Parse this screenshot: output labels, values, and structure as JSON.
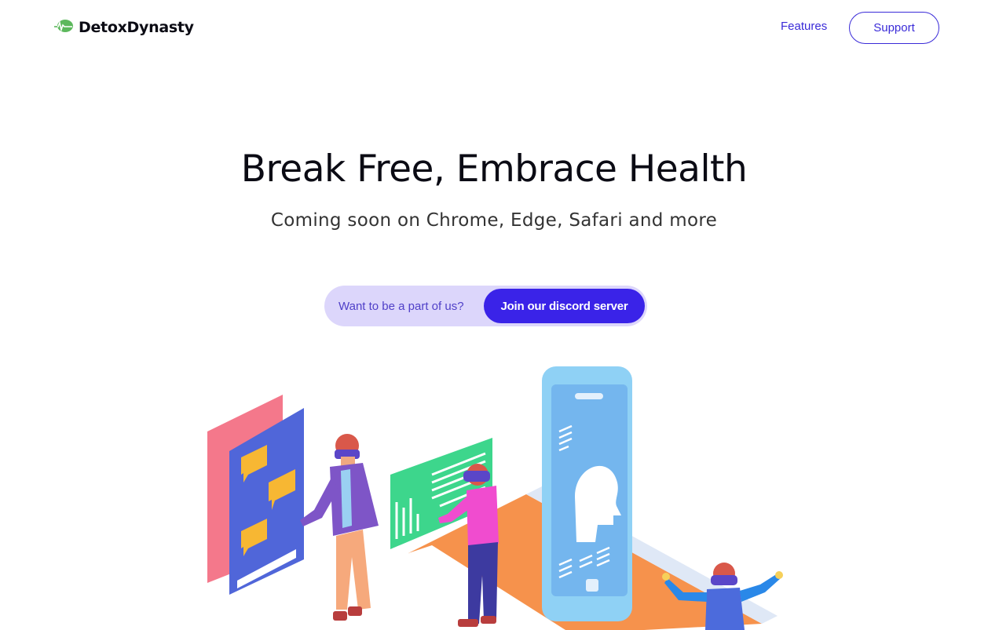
{
  "nav": {
    "brand": "DetoxDynasty",
    "features_label": "Features",
    "support_label": "Support"
  },
  "hero": {
    "title": "Break Free, Embrace Health",
    "subtitle": "Coming soon on Chrome, Edge, Safari and more"
  },
  "cta": {
    "prompt": "Want to be a part of us?",
    "button_label": "Join our discord server"
  },
  "colors": {
    "accent": "#3a23e8",
    "accent_light": "#dcd6fb",
    "brand_green": "#5cb85c"
  },
  "icons": [
    "leaf-logo-icon"
  ]
}
